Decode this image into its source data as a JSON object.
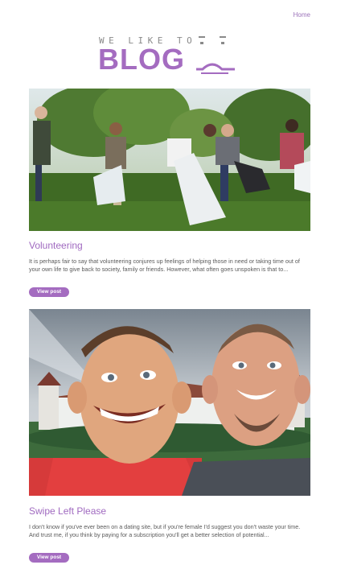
{
  "nav": {
    "home_label": "Home"
  },
  "logo": {
    "tagline": "WE LIKE TO",
    "word": "BLOG"
  },
  "posts": [
    {
      "title": "Volunteering",
      "excerpt": "It is perhaps fair to say that volunteering conjures up feelings of helping those in need or taking time out of your own life to give back to society, family or friends. However, what often goes unspoken is that to...",
      "button_label": "View post",
      "image_alt": "Volunteers picking up litter in a park"
    },
    {
      "title": "Swipe Left Please",
      "excerpt": "I don't know if you've ever been on a dating site, but if you're female I'd suggest you don't waste your time. And trust me, if you think by paying for a subscription you'll get a better selection of potential...",
      "button_label": "View post",
      "image_alt": "Caricature of two smiling men in front of a castle"
    }
  ],
  "colors": {
    "accent": "#a46cc0",
    "text": "#5a5a5a"
  }
}
